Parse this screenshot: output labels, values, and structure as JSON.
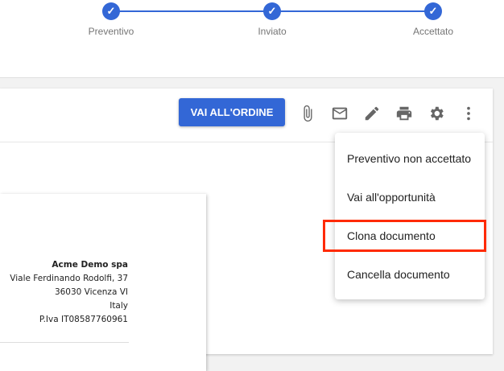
{
  "stepper": {
    "steps": [
      {
        "label": "Preventivo",
        "done": true
      },
      {
        "label": "Inviato",
        "done": true
      },
      {
        "label": "Accettato",
        "done": true
      }
    ],
    "check": "✓"
  },
  "toolbar": {
    "primary_button": "VAI ALL'ORDINE",
    "icons": [
      "paperclip-icon",
      "mail-icon",
      "pencil-icon",
      "print-icon",
      "gear-icon",
      "more-vert-icon"
    ]
  },
  "document": {
    "company": "Acme Demo spa",
    "street": "Viale Ferdinando Rodolfi, 37",
    "city": "36030 Vicenza VI",
    "country": "Italy",
    "vat": "P.Iva IT08587760961"
  },
  "menu": {
    "items": [
      "Preventivo non accettato",
      "Vai all'opportunità",
      "Clona documento",
      "Cancella documento"
    ],
    "highlighted_index": 2
  },
  "colors": {
    "accent": "#3367d6",
    "highlight": "#ff2a00"
  }
}
